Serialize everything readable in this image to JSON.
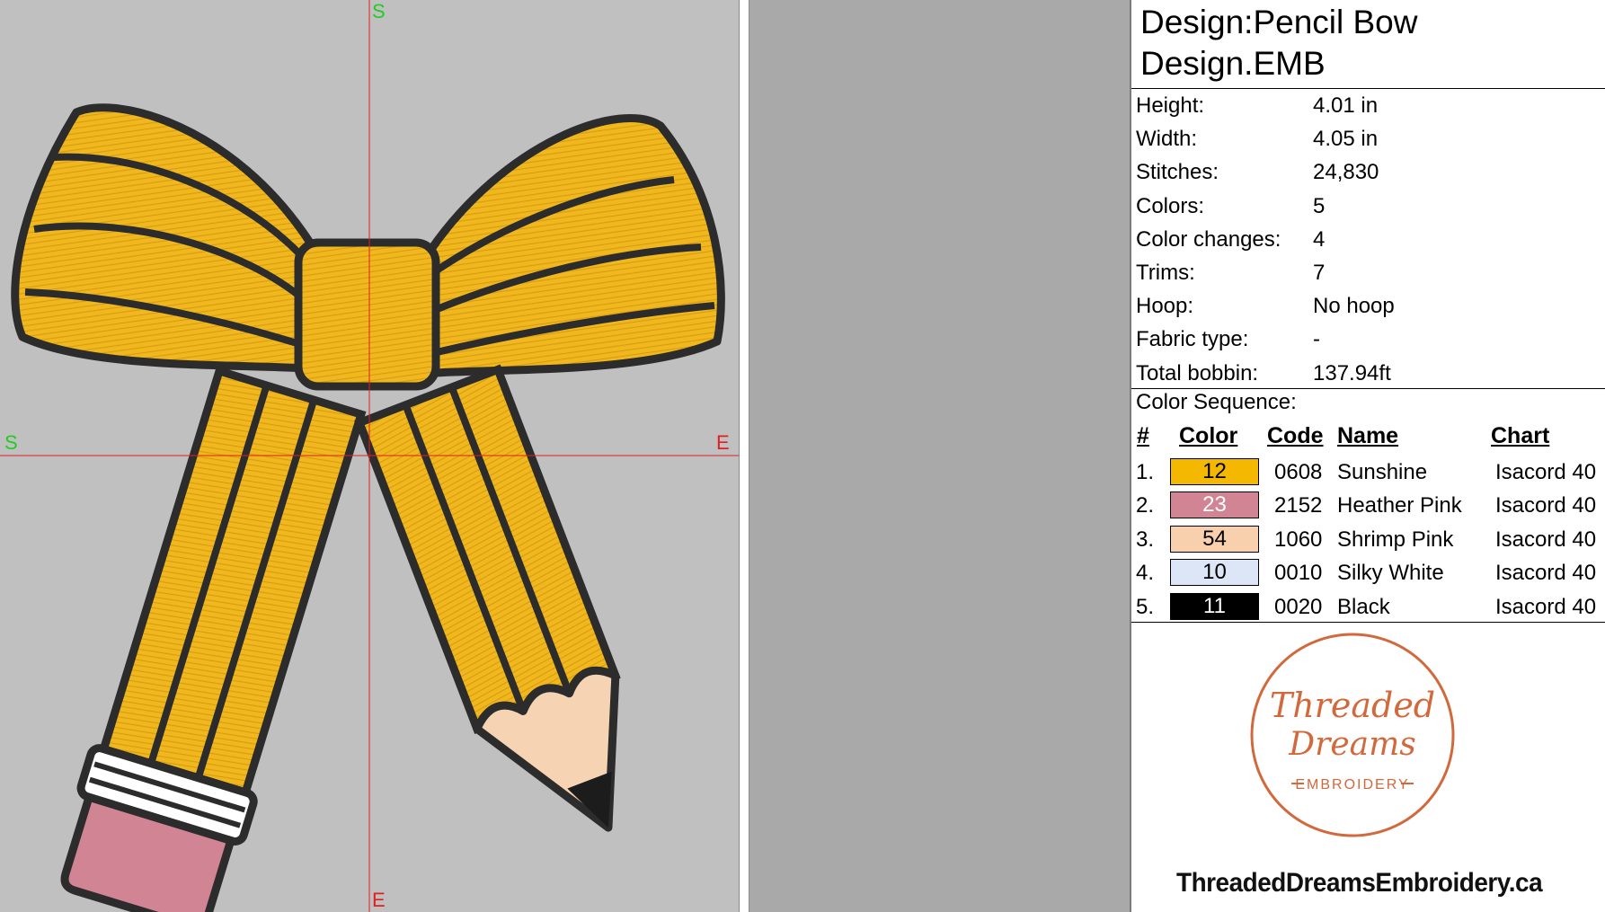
{
  "design": {
    "title_line1": "Design:Pencil Bow",
    "title_line2": "Design.EMB"
  },
  "info": [
    {
      "label": "Height:",
      "value": "4.01 in"
    },
    {
      "label": "Width:",
      "value": "4.05 in"
    },
    {
      "label": "Stitches:",
      "value": "24,830"
    },
    {
      "label": "Colors:",
      "value": "5"
    },
    {
      "label": "Color changes:",
      "value": "4"
    },
    {
      "label": "Trims:",
      "value": "7"
    },
    {
      "label": "Hoop:",
      "value": "No hoop"
    },
    {
      "label": "Fabric type:",
      "value": "-"
    },
    {
      "label": "Total bobbin:",
      "value": "137.94ft"
    }
  ],
  "color_sequence": {
    "title": "Color Sequence:",
    "headers": {
      "num": "#",
      "color": "Color",
      "code": "Code",
      "name": "Name",
      "chart": "Chart"
    },
    "rows": [
      {
        "num": "1.",
        "swatch": "12",
        "hex": "#f5b800",
        "text_color": "#000000",
        "code": "0608",
        "name": "Sunshine",
        "chart": "Isacord 40"
      },
      {
        "num": "2.",
        "swatch": "23",
        "hex": "#d08494",
        "text_color": "#ffffff",
        "code": "2152",
        "name": "Heather Pink",
        "chart": "Isacord 40"
      },
      {
        "num": "3.",
        "swatch": "54",
        "hex": "#f8d0ae",
        "text_color": "#000000",
        "code": "1060",
        "name": "Shrimp Pink",
        "chart": "Isacord 40"
      },
      {
        "num": "4.",
        "swatch": "10",
        "hex": "#dde6f6",
        "text_color": "#000000",
        "code": "0010",
        "name": "Silky White",
        "chart": "Isacord 40"
      },
      {
        "num": "5.",
        "swatch": "11",
        "hex": "#000000",
        "text_color": "#ffffff",
        "code": "0020",
        "name": "Black",
        "chart": "Isacord 40"
      }
    ]
  },
  "logo": {
    "line1": "Threaded",
    "line2": "Dreams",
    "line3": "EMBROIDERY"
  },
  "footer": {
    "url": "ThreadedDreamsEmbroidery.ca"
  },
  "axis": {
    "top": "S",
    "left": "S",
    "right": "E",
    "bottom": "E"
  },
  "colors": {
    "crosshair": "#e02020",
    "axis_label": "#22cc22",
    "logo_accent": "#d2693c"
  }
}
